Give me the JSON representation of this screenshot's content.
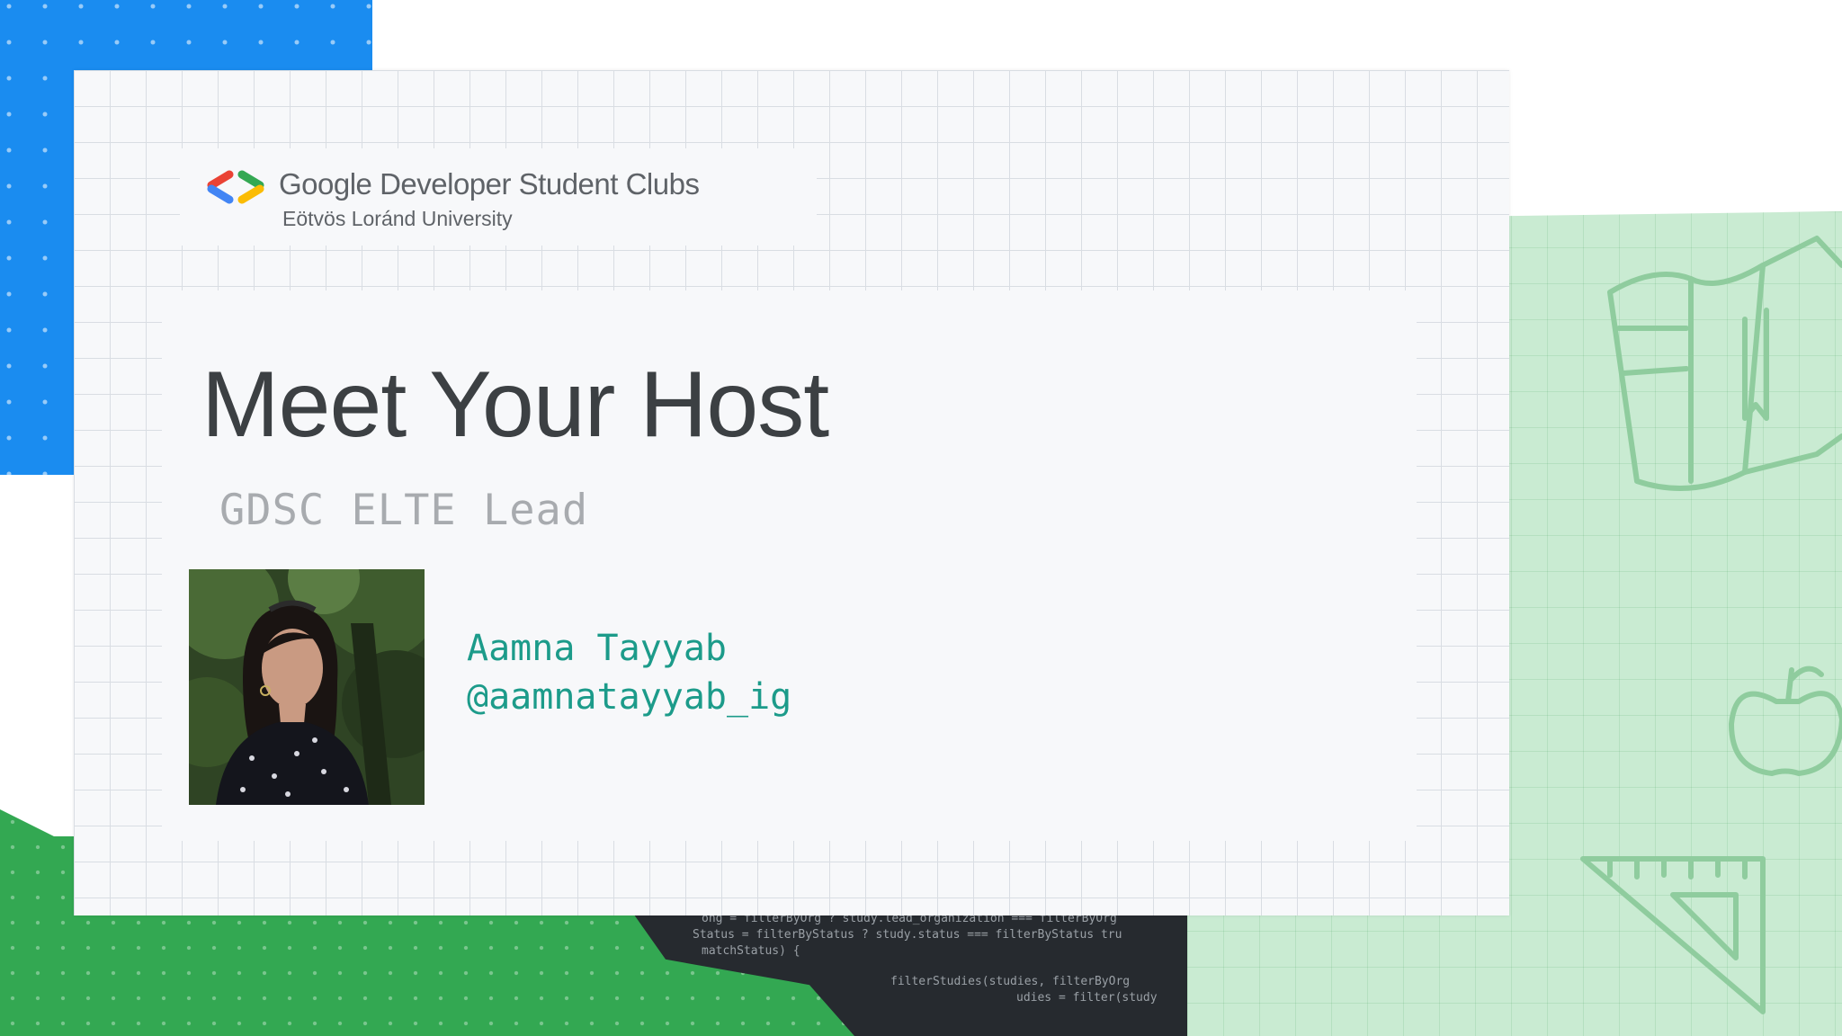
{
  "slide": {
    "logo": {
      "title": "Google Developer Student Clubs",
      "subtitle": "Eötvös Loránd University"
    },
    "title": "Meet Your Host",
    "subtitle": "GDSC ELTE Lead",
    "host": {
      "name": "Aamna Tayyab",
      "handle": "@aamnatayyab_ig"
    },
    "code_snippet": [
      "ong = filterByOrg ? study.lead_organization === filterByOrg",
      "Status = filterByStatus ? study.status === filterByStatus   tru",
      "matchStatus) {",
      "filterStudies(studies, filterByOrg",
      "udies = filter(study"
    ]
  },
  "colors": {
    "blue": "#1a8cf0",
    "green": "#33a852",
    "mint": "#c9ebd2",
    "title": "#3c4043",
    "accent_teal": "#1c9b8a"
  },
  "icons": [
    "gdsc-logo-icon",
    "book-icon",
    "globe-icon",
    "apple-icon",
    "set-square-icon"
  ]
}
